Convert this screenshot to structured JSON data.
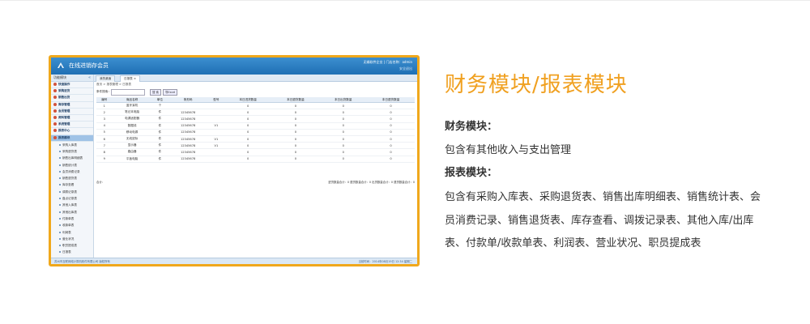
{
  "app": {
    "title": "在线进销存会员",
    "user": "无锡软件企业 | 门店名称：admin",
    "sub": "安全退出"
  },
  "sidebar": {
    "header": "功能模块",
    "items": [
      {
        "label": "快速操作"
      },
      {
        "label": "采购进货"
      },
      {
        "label": "销售出货"
      },
      {
        "label": "库存管理"
      },
      {
        "label": "会员管理"
      },
      {
        "label": "资料管理"
      },
      {
        "label": "系统管理"
      },
      {
        "label": "报表中心"
      },
      {
        "label": "报表模块"
      }
    ],
    "subitems": [
      {
        "label": "采购入库表"
      },
      {
        "label": "采购退货表"
      },
      {
        "label": "销售出库明细表"
      },
      {
        "label": "销售统计表"
      },
      {
        "label": "会员消费记录"
      },
      {
        "label": "销售退货表"
      },
      {
        "label": "库存查看"
      },
      {
        "label": "调拨记录表"
      },
      {
        "label": "盘点记录表"
      },
      {
        "label": "其他入库表"
      },
      {
        "label": "其他出库表"
      },
      {
        "label": "付款单表"
      },
      {
        "label": "收款单表"
      },
      {
        "label": "利润表"
      },
      {
        "label": "营业状况"
      },
      {
        "label": "职员提成表"
      },
      {
        "label": "日报表"
      }
    ]
  },
  "tabs": [
    {
      "label": "我的桌面"
    },
    {
      "label": "日报表"
    }
  ],
  "breadcrumb": "首页 > 报表管理 > 日报表",
  "search": {
    "label": "条件搜索：",
    "btn_search": "搜 索",
    "btn_excel": "导Excel"
  },
  "table": {
    "headers": [
      "编号",
      "商品名称",
      "单位",
      "条形码",
      "型号",
      "本日进货数量",
      "本日退货数量",
      "本日出货数量",
      "本日退货数量"
    ],
    "rows": [
      [
        "1",
        "蓝牙耳机",
        "个",
        "",
        "",
        "0",
        "0",
        "0",
        "0"
      ],
      [
        "2",
        "笔记本电脑",
        "件",
        "12345678",
        "",
        "0",
        "0",
        "0",
        "0"
      ],
      [
        "3",
        "电源适配器",
        "件",
        "12345678",
        "",
        "0",
        "0",
        "0",
        "0"
      ],
      [
        "4",
        "数据线",
        "件",
        "12345678",
        "V1",
        "0",
        "0",
        "0",
        "0"
      ],
      [
        "5",
        "移动电源",
        "件",
        "12345678",
        "",
        "0",
        "0",
        "0",
        "0"
      ],
      [
        "6",
        "无线鼠标",
        "件",
        "12345678",
        "V1",
        "0",
        "0",
        "0",
        "0"
      ],
      [
        "7",
        "显示器",
        "件",
        "12345678",
        "V1",
        "0",
        "0",
        "0",
        "0"
      ],
      [
        "8",
        "路由器",
        "件",
        "12345678",
        "",
        "0",
        "0",
        "0",
        "0"
      ],
      [
        "9",
        "平板电脑",
        "件",
        "12345678",
        "",
        "0",
        "0",
        "0",
        "0"
      ]
    ],
    "footer_left": "合计：",
    "footer_right": "进货数量合计：0 退货数量合计：0 出货数量合计：0 退货数量合计：0"
  },
  "statusbar": {
    "left": "苏州市互联网络计算机软件有限公司 版权所有",
    "right": "当前时间：2014年08月19日 12:34 星期二"
  },
  "heading": "财务模块/报表模块",
  "finance_title": "财务模块：",
  "finance_desc": "包含有其他收入与支出管理",
  "report_title": "报表模块：",
  "report_line1": "包含有采购入库表、采购退货表、销售出库明细表、销售统计表、会",
  "report_line2": "员消费记录、销售退货表、库存查看、调拨记录表、其他入库/出库",
  "report_line3": "表、付款单/收款单表、利润表、营业状况、职员提成表",
  "colors": {
    "accent": "#f0a020",
    "frame": "#f0a81c",
    "appbar": "#2a7cc0"
  }
}
